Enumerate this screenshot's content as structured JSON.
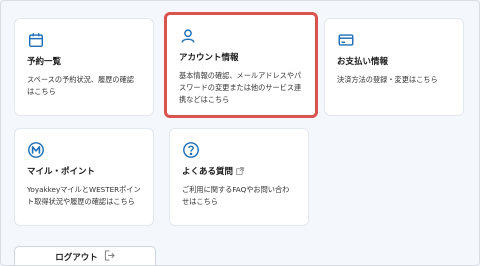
{
  "cards": [
    {
      "title": "予約一覧",
      "desc": "スペースの予約状況、履歴の確認はこちら",
      "icon": "calendar-icon"
    },
    {
      "title": "アカウント情報",
      "desc": "基本情報の確認、メールアドレスやパスワードの変更または他のサービス連携などはこちら",
      "icon": "user-icon"
    },
    {
      "title": "お支払い情報",
      "desc": "決済方法の登録・変更はこちら",
      "icon": "card-icon"
    },
    {
      "title": "マイル・ポイント",
      "desc": "YoyakkeyマイルとWESTERポイント取得状況や履歴の確認はこちら",
      "icon": "mile-icon"
    },
    {
      "title": "よくある質問",
      "desc": "ご利用に関するFAQやお問い合わせはこちら",
      "icon": "question-icon"
    }
  ],
  "logout": {
    "label": "ログアウト",
    "icon": "logout-icon"
  },
  "colors": {
    "accent": "#1f6fb8",
    "highlight": "#d9534f"
  }
}
